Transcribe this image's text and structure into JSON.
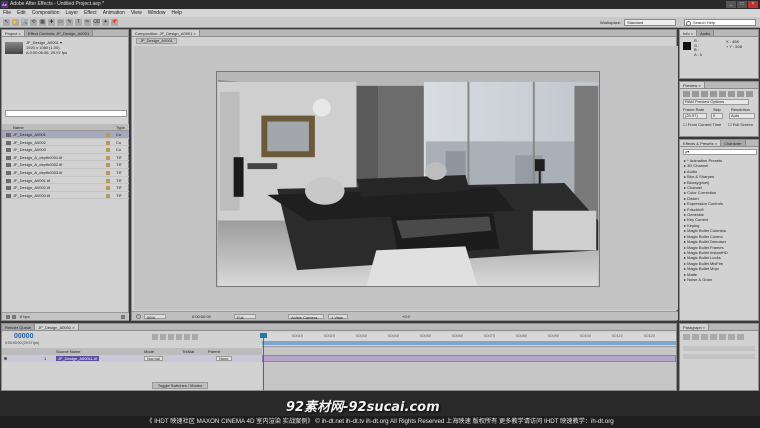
{
  "window": {
    "app_icon": "Ae",
    "title": "Adobe After Effects - Untitled Project.aep *",
    "min_label": "_",
    "max_label": "□",
    "close_label": "×"
  },
  "menu": [
    "File",
    "Edit",
    "Composition",
    "Layer",
    "Effect",
    "Animation",
    "View",
    "Window",
    "Help"
  ],
  "toolbar": {
    "workspace_label": "Workspace:",
    "workspace_value": "Standard",
    "search_placeholder": "Search Help",
    "tools": [
      "↖",
      "✋",
      "🔍",
      "⟲",
      "▦",
      "✚",
      "▭",
      "✎",
      "T",
      "✏",
      "⌫",
      "✦",
      "📌"
    ]
  },
  "project_panel": {
    "tabs": [
      "Project ×",
      "Effect Controls: JF_Design_A0001"
    ],
    "selected_item": "JF_Design_A0001 ▾",
    "info_lines": [
      "1920 x 1080 (1.00)",
      "Δ 0:00:06:06, 29.97 fps"
    ],
    "columns": {
      "name": "Name",
      "type": "Type"
    },
    "items": [
      {
        "name": "JF_Design_A0001",
        "type": "Co"
      },
      {
        "name": "JF_Design_A0002",
        "type": "Co"
      },
      {
        "name": "JF_Design_A0003",
        "type": "Co"
      },
      {
        "name": "JF_Design_A_depth0001.tif",
        "type": "TIF"
      },
      {
        "name": "JF_Design_A_depth0002.tif",
        "type": "TIF"
      },
      {
        "name": "JF_Design_A_depth0003.tif",
        "type": "TIF"
      },
      {
        "name": "JF_Design_A0001.tif",
        "type": "TIF"
      },
      {
        "name": "JF_Design_A0002.tif",
        "type": "TIF"
      },
      {
        "name": "JF_Design_A0003.tif",
        "type": "TIF"
      }
    ],
    "bottom_label": "8 bpc"
  },
  "composition": {
    "tab": "Composition: JF_Design_A0001 ×",
    "crumb": "JF_Design_A0001",
    "zoom": "50%",
    "timecode": "0:00:00:00",
    "resolution": "Full",
    "camera": "Active Camera",
    "views": "1 View",
    "exposure": "+0.0"
  },
  "info_panel": {
    "tabs": [
      "Info ×",
      "Audio"
    ],
    "r": "R :",
    "g": "G :",
    "b": "B :",
    "a": "A : 0",
    "x": "X : 458",
    "y": "+ Y : 508"
  },
  "preview_panel": {
    "tab": "Preview ×",
    "ram_label": "RAM Preview Options",
    "frame_rate_label": "Frame Rate",
    "skip_label": "Skip",
    "resolution_label": "Resolution",
    "frame_rate_value": "(29.97)",
    "skip_value": "0",
    "resolution_value": "Auto",
    "from_current": "From Current Time",
    "full_screen": "Full Screen"
  },
  "effects_panel": {
    "tabs": [
      "Effects & Presets ×",
      "Character"
    ],
    "search_placeholder": "ρ▾",
    "items": [
      "* Animation Presets",
      "3D Channel",
      "Audio",
      "Blur & Sharpen",
      "Bluray(pixel)",
      "Channel",
      "Color Correction",
      "Distort",
      "Expression Controls",
      "FrischIuft",
      "Generate",
      "Key Correct",
      "Keying",
      "Magic Bullet Colorista",
      "Magic Bullet Cosmo",
      "Magic Bullet Denoiser",
      "Magic Bullet Frames",
      "Magic Bullet InstantHD",
      "Magic Bullet Looks",
      "Magic Bullet MisFire",
      "Magic Bullet Mojo",
      "Matte",
      "Noise & Grain"
    ]
  },
  "paragraph_panel": {
    "tab": "Paragraph ×"
  },
  "timeline": {
    "tabs": [
      "Render Queue",
      "JF_Design_A0001 ×"
    ],
    "timecode": "00000",
    "timecode_sub": "0:00:00:00 (29.97 fps)",
    "columns": {
      "source": "Source Name",
      "mode": "Mode",
      "trkmat": "TrkMat",
      "parent": "Parent"
    },
    "ruler": [
      "00010",
      "00020",
      "00030",
      "00040",
      "00050",
      "00060",
      "00070",
      "00080",
      "00090",
      "00100",
      "00110",
      "00120",
      "00130"
    ],
    "layers": [
      {
        "num": "1",
        "name": "JF_Design_A00011.tif",
        "mode": "Normal",
        "parent": "None"
      }
    ],
    "toggle_label": "Toggle Switches / Modes"
  },
  "watermark": {
    "brand": "92素材网-92sucai.com",
    "caption": "《 IHDT 映速社区 MAXON CINEMA 4D 室内渲染 实战案例》 © ih-dt.net ih-dt.tv  ih-dt.org  All Rights Reserved 上海映速 版权所有   更多教学请访问 IHDT 映速教学：ih-dt.org"
  },
  "colors": {
    "accent": "#5b2b8a",
    "selection": "#a7a7bd",
    "panel": "#d2d2d2",
    "cti": "#1d7ab3"
  }
}
